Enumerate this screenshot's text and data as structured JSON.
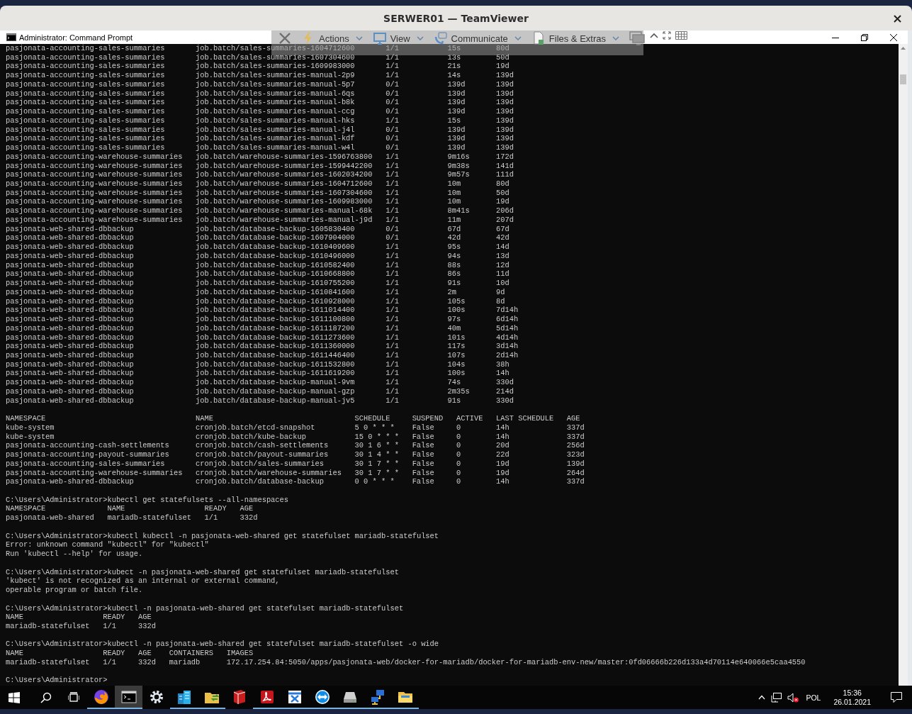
{
  "teamviewer": {
    "title": "SERWER01 — TeamViewer"
  },
  "remote_toolbar": {
    "menus": [
      {
        "kind": "lightning",
        "label": "Actions"
      },
      {
        "kind": "monitor",
        "label": "View"
      },
      {
        "kind": "chat",
        "label": "Communicate"
      },
      {
        "kind": "file",
        "label": "Files & Extras"
      }
    ]
  },
  "cmd_window": {
    "title": "Administrator: Command Prompt"
  },
  "console": {
    "blocks": [
      {
        "table": {
          "kind": "jobs",
          "rows": [
            [
              "pasjonata-accounting-sales-summaries",
              "job.batch/sales-summaries-1604712600",
              "1/1",
              "15s",
              "80d"
            ],
            [
              "pasjonata-accounting-sales-summaries",
              "job.batch/sales-summaries-1607304600",
              "1/1",
              "13s",
              "50d"
            ],
            [
              "pasjonata-accounting-sales-summaries",
              "job.batch/sales-summaries-1609983000",
              "1/1",
              "21s",
              "19d"
            ],
            [
              "pasjonata-accounting-sales-summaries",
              "job.batch/sales-summaries-manual-2p9",
              "1/1",
              "14s",
              "139d"
            ],
            [
              "pasjonata-accounting-sales-summaries",
              "job.batch/sales-summaries-manual-5p7",
              "0/1",
              "139d",
              "139d"
            ],
            [
              "pasjonata-accounting-sales-summaries",
              "job.batch/sales-summaries-manual-6qs",
              "0/1",
              "139d",
              "139d"
            ],
            [
              "pasjonata-accounting-sales-summaries",
              "job.batch/sales-summaries-manual-b8k",
              "0/1",
              "139d",
              "139d"
            ],
            [
              "pasjonata-accounting-sales-summaries",
              "job.batch/sales-summaries-manual-ccg",
              "0/1",
              "139d",
              "139d"
            ],
            [
              "pasjonata-accounting-sales-summaries",
              "job.batch/sales-summaries-manual-hks",
              "1/1",
              "15s",
              "139d"
            ],
            [
              "pasjonata-accounting-sales-summaries",
              "job.batch/sales-summaries-manual-j4l",
              "0/1",
              "139d",
              "139d"
            ],
            [
              "pasjonata-accounting-sales-summaries",
              "job.batch/sales-summaries-manual-kdf",
              "0/1",
              "139d",
              "139d"
            ],
            [
              "pasjonata-accounting-sales-summaries",
              "job.batch/sales-summaries-manual-w4l",
              "0/1",
              "139d",
              "139d"
            ],
            [
              "pasjonata-accounting-warehouse-summaries",
              "job.batch/warehouse-summaries-1596763800",
              "1/1",
              "9m16s",
              "172d"
            ],
            [
              "pasjonata-accounting-warehouse-summaries",
              "job.batch/warehouse-summaries-1599442200",
              "1/1",
              "9m38s",
              "141d"
            ],
            [
              "pasjonata-accounting-warehouse-summaries",
              "job.batch/warehouse-summaries-1602034200",
              "1/1",
              "9m57s",
              "111d"
            ],
            [
              "pasjonata-accounting-warehouse-summaries",
              "job.batch/warehouse-summaries-1604712600",
              "1/1",
              "10m",
              "80d"
            ],
            [
              "pasjonata-accounting-warehouse-summaries",
              "job.batch/warehouse-summaries-1607304600",
              "1/1",
              "10m",
              "50d"
            ],
            [
              "pasjonata-accounting-warehouse-summaries",
              "job.batch/warehouse-summaries-1609983000",
              "1/1",
              "10m",
              "19d"
            ],
            [
              "pasjonata-accounting-warehouse-summaries",
              "job.batch/warehouse-summaries-manual-68k",
              "1/1",
              "8m41s",
              "206d"
            ],
            [
              "pasjonata-accounting-warehouse-summaries",
              "job.batch/warehouse-summaries-manual-j9d",
              "1/1",
              "11m",
              "207d"
            ],
            [
              "pasjonata-web-shared-dbbackup",
              "job.batch/database-backup-1605830400",
              "0/1",
              "67d",
              "67d"
            ],
            [
              "pasjonata-web-shared-dbbackup",
              "job.batch/database-backup-1607904000",
              "0/1",
              "42d",
              "42d"
            ],
            [
              "pasjonata-web-shared-dbbackup",
              "job.batch/database-backup-1610409600",
              "1/1",
              "95s",
              "14d"
            ],
            [
              "pasjonata-web-shared-dbbackup",
              "job.batch/database-backup-1610496000",
              "1/1",
              "94s",
              "13d"
            ],
            [
              "pasjonata-web-shared-dbbackup",
              "job.batch/database-backup-1610582400",
              "1/1",
              "88s",
              "12d"
            ],
            [
              "pasjonata-web-shared-dbbackup",
              "job.batch/database-backup-1610668800",
              "1/1",
              "86s",
              "11d"
            ],
            [
              "pasjonata-web-shared-dbbackup",
              "job.batch/database-backup-1610755200",
              "1/1",
              "91s",
              "10d"
            ],
            [
              "pasjonata-web-shared-dbbackup",
              "job.batch/database-backup-1610841600",
              "1/1",
              "2m",
              "9d"
            ],
            [
              "pasjonata-web-shared-dbbackup",
              "job.batch/database-backup-1610928000",
              "1/1",
              "105s",
              "8d"
            ],
            [
              "pasjonata-web-shared-dbbackup",
              "job.batch/database-backup-1611014400",
              "1/1",
              "100s",
              "7d14h"
            ],
            [
              "pasjonata-web-shared-dbbackup",
              "job.batch/database-backup-1611100800",
              "1/1",
              "97s",
              "6d14h"
            ],
            [
              "pasjonata-web-shared-dbbackup",
              "job.batch/database-backup-1611187200",
              "1/1",
              "40m",
              "5d14h"
            ],
            [
              "pasjonata-web-shared-dbbackup",
              "job.batch/database-backup-1611273600",
              "1/1",
              "101s",
              "4d14h"
            ],
            [
              "pasjonata-web-shared-dbbackup",
              "job.batch/database-backup-1611360000",
              "1/1",
              "117s",
              "3d14h"
            ],
            [
              "pasjonata-web-shared-dbbackup",
              "job.batch/database-backup-1611446400",
              "1/1",
              "107s",
              "2d14h"
            ],
            [
              "pasjonata-web-shared-dbbackup",
              "job.batch/database-backup-1611532800",
              "1/1",
              "104s",
              "38h"
            ],
            [
              "pasjonata-web-shared-dbbackup",
              "job.batch/database-backup-1611619200",
              "1/1",
              "100s",
              "14h"
            ],
            [
              "pasjonata-web-shared-dbbackup",
              "job.batch/database-backup-manual-9vm",
              "1/1",
              "74s",
              "330d"
            ],
            [
              "pasjonata-web-shared-dbbackup",
              "job.batch/database-backup-manual-gzp",
              "1/1",
              "2m35s",
              "214d"
            ],
            [
              "pasjonata-web-shared-dbbackup",
              "job.batch/database-backup-manual-jv5",
              "1/1",
              "91s",
              "330d"
            ]
          ]
        }
      },
      {
        "table": {
          "kind": "cronjobs",
          "header": [
            "NAMESPACE",
            "NAME",
            "SCHEDULE",
            "SUSPEND",
            "ACTIVE",
            "LAST SCHEDULE",
            "AGE"
          ],
          "rows": [
            [
              "kube-system",
              "cronjob.batch/etcd-snapshot",
              "5 0 * * *",
              "False",
              "0",
              "14h",
              "337d"
            ],
            [
              "kube-system",
              "cronjob.batch/kube-backup",
              "15 0 * * *",
              "False",
              "0",
              "14h",
              "337d"
            ],
            [
              "pasjonata-accounting-cash-settlements",
              "cronjob.batch/cash-settlements",
              "30 1 6 * *",
              "False",
              "0",
              "20d",
              "256d"
            ],
            [
              "pasjonata-accounting-payout-summaries",
              "cronjob.batch/payout-summaries",
              "30 1 4 * *",
              "False",
              "0",
              "22d",
              "323d"
            ],
            [
              "pasjonata-accounting-sales-summaries",
              "cronjob.batch/sales-summaries",
              "30 1 7 * *",
              "False",
              "0",
              "19d",
              "139d"
            ],
            [
              "pasjonata-accounting-warehouse-summaries",
              "cronjob.batch/warehouse-summaries",
              "30 1 7 * *",
              "False",
              "0",
              "19d",
              "264d"
            ],
            [
              "pasjonata-web-shared-dbbackup",
              "cronjob.batch/database-backup",
              "0 0 * * *",
              "False",
              "0",
              "14h",
              "337d"
            ]
          ]
        }
      },
      {
        "command_line": "C:\\Users\\Administrator>kubectl get statefulsets --all-namespaces",
        "table": {
          "kind": "statefulsets",
          "header": [
            "NAMESPACE",
            "NAME",
            "READY",
            "AGE"
          ],
          "rows": [
            [
              "pasjonata-web-shared",
              "mariadb-statefulset",
              "1/1",
              "332d"
            ]
          ]
        }
      },
      {
        "command_line": "C:\\Users\\Administrator>kubectl kubectl -n pasjonata-web-shared get statefulset mariadb-statefulset",
        "lines": [
          "Error: unknown command \"kubectl\" for \"kubectl\"",
          "Run 'kubectl --help' for usage."
        ]
      },
      {
        "command_line": "C:\\Users\\Administrator>kubect -n pasjonata-web-shared get statefulset mariadb-statefulset",
        "lines": [
          "'kubect' is not recognized as an internal or external command,",
          "operable program or batch file."
        ]
      },
      {
        "command_line": "C:\\Users\\Administrator>kubectl -n pasjonata-web-shared get statefulset mariadb-statefulset",
        "table": {
          "kind": "statefulset",
          "header": [
            "NAME",
            "READY",
            "AGE"
          ],
          "rows": [
            [
              "mariadb-statefulset",
              "1/1",
              "332d"
            ]
          ]
        }
      },
      {
        "command_line": "C:\\Users\\Administrator>kubectl -n pasjonata-web-shared get statefulset mariadb-statefulset -o wide",
        "table": {
          "kind": "wide",
          "header": [
            "NAME",
            "READY",
            "AGE",
            "CONTAINERS",
            "IMAGES"
          ],
          "rows": [
            [
              "mariadb-statefulset",
              "1/1",
              "332d",
              "mariadb",
              "172.17.254.84:5050/apps/pasjonata-web/docker-for-mariadb/docker-for-mariadb-env-new/master:0fd06666b226d133a4d70114e640066e5caa4550"
            ]
          ]
        }
      },
      {
        "command_line": "C:\\Users\\Administrator>"
      }
    ]
  },
  "taskbar": {
    "apps": [
      {
        "kind": "browser",
        "running": true,
        "selected": false
      },
      {
        "kind": "terminal",
        "running": true,
        "selected": true
      },
      {
        "kind": "settings",
        "running": false,
        "selected": false
      },
      {
        "kind": "buildings",
        "running": true,
        "selected": false
      },
      {
        "kind": "files-sync",
        "running": true,
        "selected": false
      },
      {
        "kind": "book",
        "running": false,
        "selected": false
      },
      {
        "kind": "pdf",
        "running": true,
        "selected": false
      },
      {
        "kind": "tool",
        "running": true,
        "selected": false
      },
      {
        "kind": "remote",
        "running": true,
        "selected": false
      },
      {
        "kind": "drive",
        "running": true,
        "selected": false
      },
      {
        "kind": "network",
        "running": true,
        "selected": false
      },
      {
        "kind": "folder",
        "running": true,
        "selected": false
      }
    ],
    "language": "POL",
    "time": "15:36",
    "date": "26.01.2021"
  }
}
